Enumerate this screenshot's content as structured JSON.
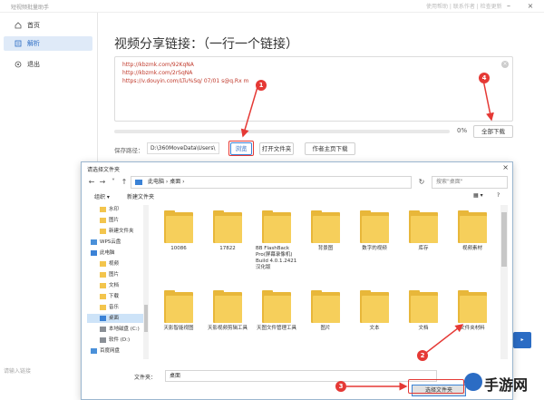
{
  "app": {
    "title": "短视频批量助手",
    "badge": "使用帮助 | 联系作者 | 检查更新"
  },
  "sidebar": {
    "items": [
      {
        "label": "首页",
        "icon": "home-icon"
      },
      {
        "label": "解析",
        "icon": "list-icon"
      },
      {
        "label": "退出",
        "icon": "exit-icon"
      }
    ],
    "input_placeholder": "请输入链接"
  },
  "main": {
    "title": "视频分享链接：（一行一个链接）",
    "links": [
      "http://kbzmk.com/92KqNA",
      "http://kbzmk.com/2rSqNA",
      "https://v.douyin.com/LTu%Sq/ 07/01 s@q.Rx m"
    ],
    "progress_percent": 0,
    "progress_text": "0%",
    "download_all": "全部下载",
    "save_label": "保存路径：",
    "save_path": "D:\\360MoveData\\Users\\",
    "browse": "浏览",
    "open_folder": "打开文件夹",
    "author_home": "作者主页下载"
  },
  "dialog": {
    "title": "请选择文件夹",
    "address": "此电脑 › 桌面 ›",
    "search_placeholder": "搜索\"桌面\"",
    "organize": "组织 ▾",
    "new_folder": "新建文件夹",
    "tree": [
      {
        "label": "水印",
        "icon": "folder"
      },
      {
        "label": "图片",
        "icon": "folder"
      },
      {
        "label": "新建文件夹",
        "icon": "folder"
      },
      {
        "label": "WPS云盘",
        "icon": "net"
      },
      {
        "label": "此电脑",
        "icon": "pc"
      },
      {
        "label": "视频",
        "icon": "folder"
      },
      {
        "label": "图片",
        "icon": "folder"
      },
      {
        "label": "文档",
        "icon": "folder"
      },
      {
        "label": "下载",
        "icon": "folder"
      },
      {
        "label": "音乐",
        "icon": "folder"
      },
      {
        "label": "桌面",
        "icon": "pc"
      },
      {
        "label": "本地磁盘 (C:)",
        "icon": "drive"
      },
      {
        "label": "软件 (D:)",
        "icon": "drive"
      },
      {
        "label": "百度网盘",
        "icon": "net"
      }
    ],
    "files_row1": [
      "10086",
      "17822",
      "BB FlashBack Pro(屏幕录像机) Build 4.0.1.2421 汉化版",
      "背景图",
      "数字的视频",
      "库存",
      "视频素材"
    ],
    "files_row2": [
      "天影智能视图",
      "天影视频剪辑工具",
      "天图文件管理工具",
      "图片",
      "文本",
      "文档",
      "文件夹材料"
    ],
    "filename_label": "文件夹：",
    "filename_value": "桌面",
    "select_btn": "选择文件夹",
    "cancel_btn": "取消"
  },
  "markers": [
    "1",
    "2",
    "3",
    "4"
  ],
  "watermark": "手游网"
}
